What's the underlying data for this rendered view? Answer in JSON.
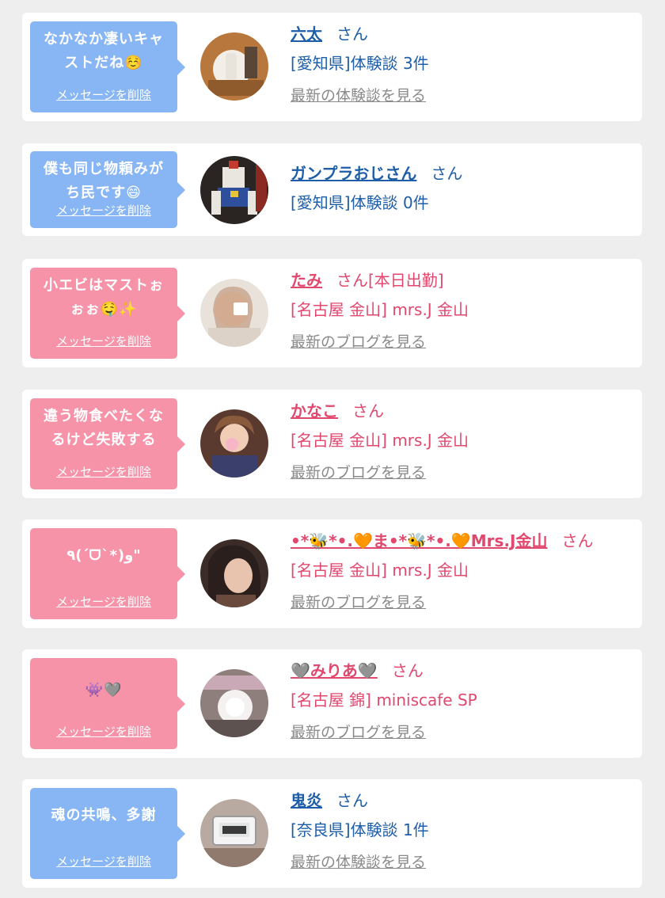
{
  "delete_label": "メッセージを削除",
  "colors": {
    "blue_bubble": "#88b6f4",
    "pink_bubble": "#f693a8",
    "blue_text": "#1e5ea8",
    "pink_text": "#e0486e",
    "link_gray": "#8a8a8a"
  },
  "items": [
    {
      "message": "なかなか凄いキャストだね☺️",
      "name": "六太",
      "suffix": "さん",
      "sub": "[愛知県]体験談 3件",
      "link": "最新の体験談を見る",
      "avatar_icon": "user-photo"
    },
    {
      "message": "僕も同じ物頼みがち民です😄",
      "name": "ガンプラおじさん",
      "suffix": "さん",
      "sub": "[愛知県]体験談 0件",
      "link": "",
      "avatar_icon": "gundam-photo"
    },
    {
      "message": "小エビはマストぉぉぉ🤤✨",
      "name": "たみ",
      "suffix": "さん[本日出勤]",
      "sub": "[名古屋 金山] mrs.J 金山",
      "link": "最新のブログを見る",
      "avatar_icon": "cast-photo"
    },
    {
      "message": "違う物食べたくなるけど失敗する",
      "name": "かなこ",
      "suffix": "さん",
      "sub": "[名古屋 金山] mrs.J 金山",
      "link": "最新のブログを見る",
      "avatar_icon": "cast-photo"
    },
    {
      "message": "٩(ˊᗜˋ*)و\"",
      "name": "•*🐝*•.🧡ま•*🐝*•.🧡Mrs.J金山",
      "suffix": "さん",
      "sub": "[名古屋 金山] mrs.J 金山",
      "link": "最新のブログを見る",
      "avatar_icon": "cast-photo"
    },
    {
      "message": "👾🩶",
      "name": "🩶みりあ🩶",
      "suffix": "さん",
      "sub": "[名古屋 錦] miniscafe SP",
      "link": "最新のブログを見る",
      "avatar_icon": "cast-photo"
    },
    {
      "message": "魂の共鳴、多謝",
      "name": "鬼炎",
      "suffix": "さん",
      "sub": "[奈良県]体験談 1件",
      "link": "最新の体験談を見る",
      "avatar_icon": "clock-photo"
    }
  ]
}
